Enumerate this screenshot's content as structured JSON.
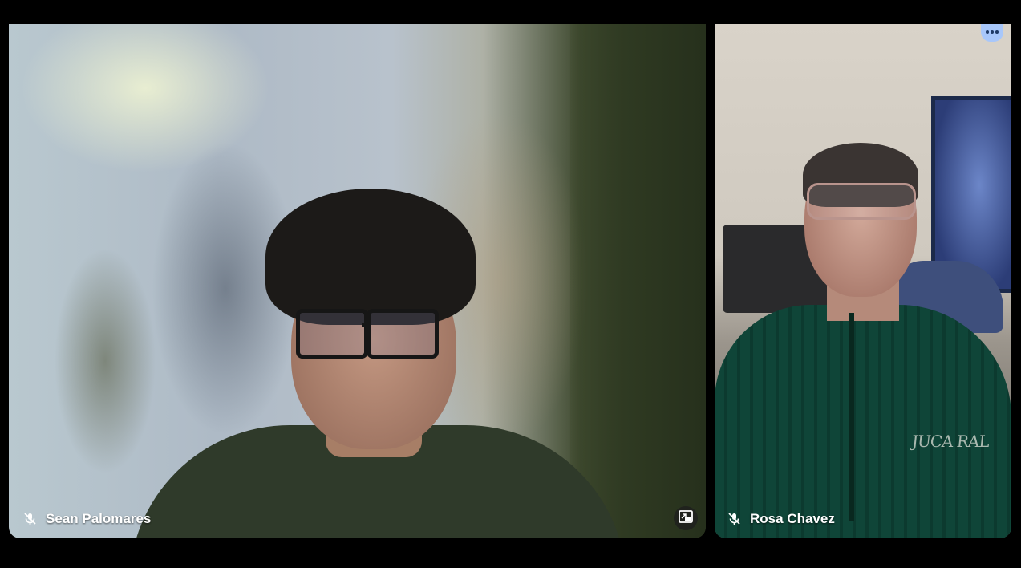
{
  "participants": [
    {
      "name": "Sean Palomares",
      "mic_icon": "mic-off-icon",
      "action_icon": "picture-in-picture-icon"
    },
    {
      "name": "Rosa Chavez",
      "mic_icon": "mic-off-icon",
      "action_icon": "more-options-icon",
      "shirt_text": "JUCA RAL"
    }
  ],
  "colors": {
    "background": "#000000",
    "tag_text": "#ffffff",
    "more_button": "#a8c7fa"
  }
}
